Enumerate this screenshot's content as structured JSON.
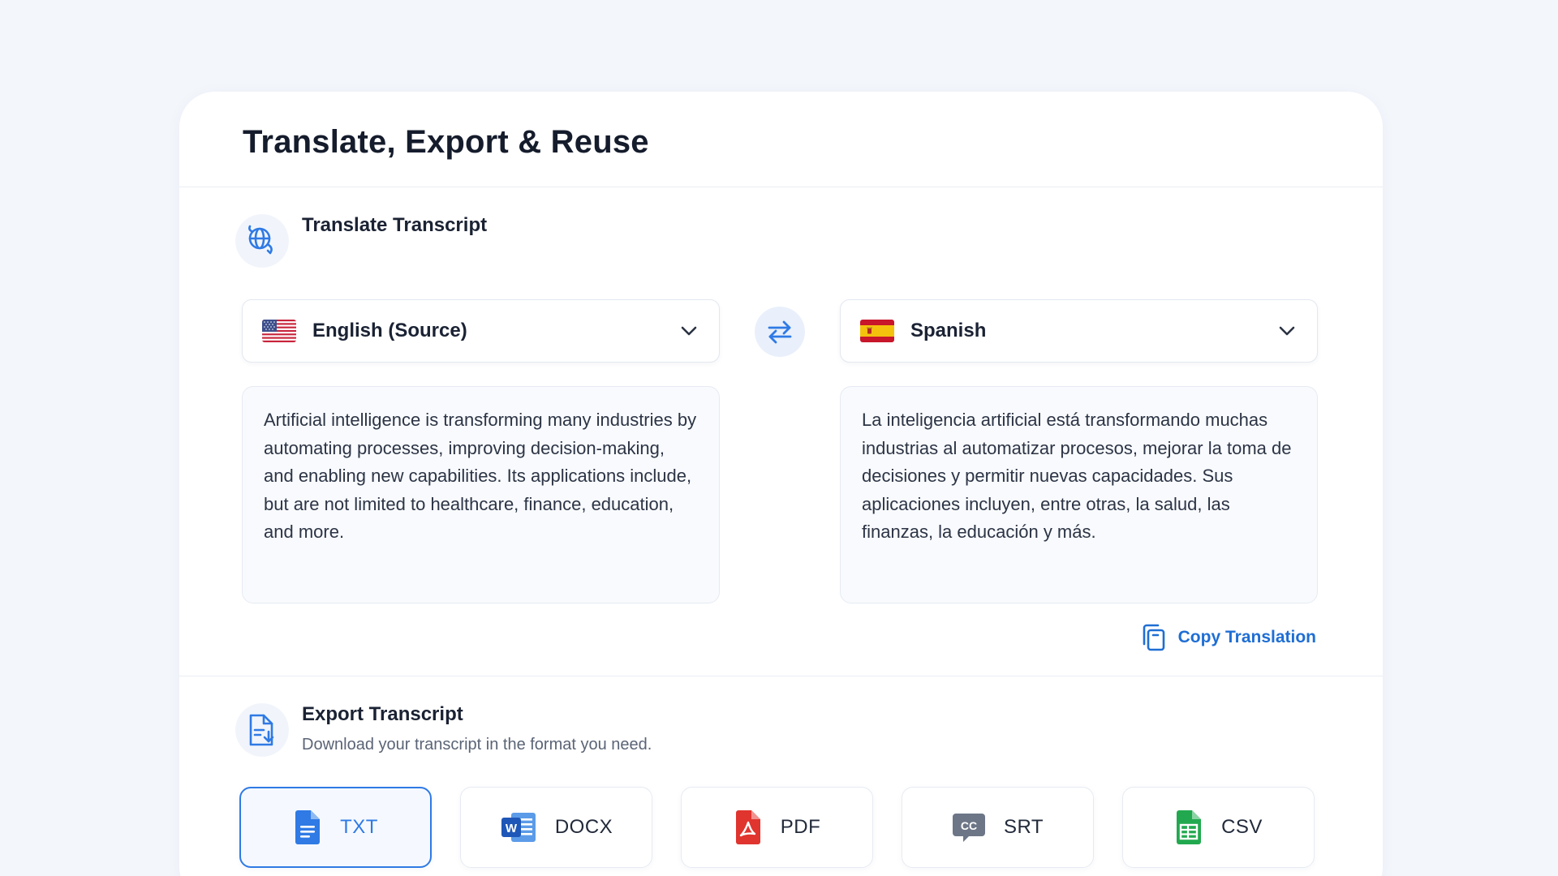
{
  "page": {
    "title": "Translate, Export & Reuse"
  },
  "translate": {
    "title": "Translate Transcript",
    "source": {
      "language": "English (Source)",
      "text": "Artificial intelligence is transforming many industries by automating processes, improving decision-making, and enabling new capabilities. Its applications include, but are not limited to healthcare, finance, education, and more."
    },
    "target": {
      "language": "Spanish",
      "text": "La inteligencia artificial está transformando muchas industrias al automatizar procesos, mejorar la toma de decisiones y permitir nuevas capacidades. Sus aplicaciones incluyen, entre otras, la salud, las finanzas, la educación y más."
    },
    "copy_label": "Copy Translation"
  },
  "export": {
    "title": "Export Transcript",
    "subtitle": "Download your transcript in the format you need.",
    "formats": [
      {
        "label": "TXT",
        "icon": "txt-file-icon",
        "selected": true
      },
      {
        "label": "DOCX",
        "icon": "word-doc-icon",
        "selected": false
      },
      {
        "label": "PDF",
        "icon": "pdf-file-icon",
        "selected": false
      },
      {
        "label": "SRT",
        "icon": "closed-caption-icon",
        "selected": false
      },
      {
        "label": "CSV",
        "icon": "spreadsheet-icon",
        "selected": false
      }
    ]
  },
  "colors": {
    "accent": "#2f7ae5",
    "link": "#1f6ed4",
    "background": "#f3f6fb"
  }
}
